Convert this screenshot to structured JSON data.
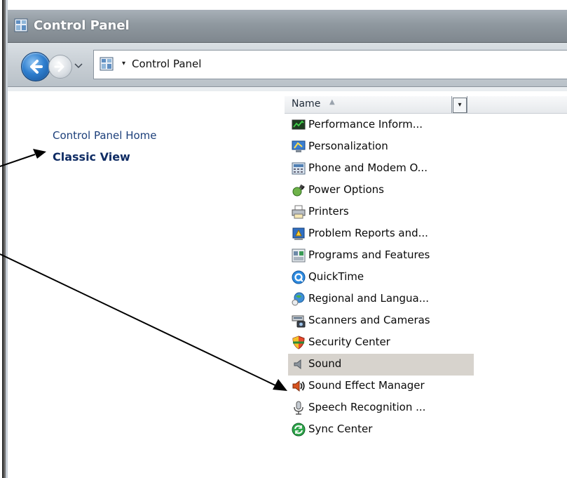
{
  "window": {
    "title": "Control Panel"
  },
  "address_bar": {
    "path": "Control Panel"
  },
  "tasks": {
    "home_label": "Control Panel Home",
    "classic_label": "Classic View"
  },
  "columns": {
    "name_label": "Name"
  },
  "items": [
    {
      "label": "Performance Inform...",
      "icon": "performance-icon"
    },
    {
      "label": "Personalization",
      "icon": "personalization-icon"
    },
    {
      "label": "Phone and Modem O...",
      "icon": "phone-modem-icon"
    },
    {
      "label": "Power Options",
      "icon": "power-options-icon"
    },
    {
      "label": "Printers",
      "icon": "printers-icon"
    },
    {
      "label": "Problem Reports and...",
      "icon": "problem-reports-icon"
    },
    {
      "label": "Programs and Features",
      "icon": "programs-features-icon"
    },
    {
      "label": "QuickTime",
      "icon": "quicktime-icon"
    },
    {
      "label": "Regional and Langua...",
      "icon": "regional-icon"
    },
    {
      "label": "Scanners and Cameras",
      "icon": "scanners-icon"
    },
    {
      "label": "Security Center",
      "icon": "security-center-icon"
    },
    {
      "label": "Sound",
      "icon": "sound-icon",
      "selected": true
    },
    {
      "label": "Sound Effect Manager",
      "icon": "sound-effect-icon"
    },
    {
      "label": "Speech Recognition ...",
      "icon": "speech-icon"
    },
    {
      "label": "Sync Center",
      "icon": "sync-center-icon"
    }
  ],
  "colors": {
    "title_bar": "#8f989f",
    "link": "#1c3f7a",
    "selection": "#d7d3cd"
  }
}
